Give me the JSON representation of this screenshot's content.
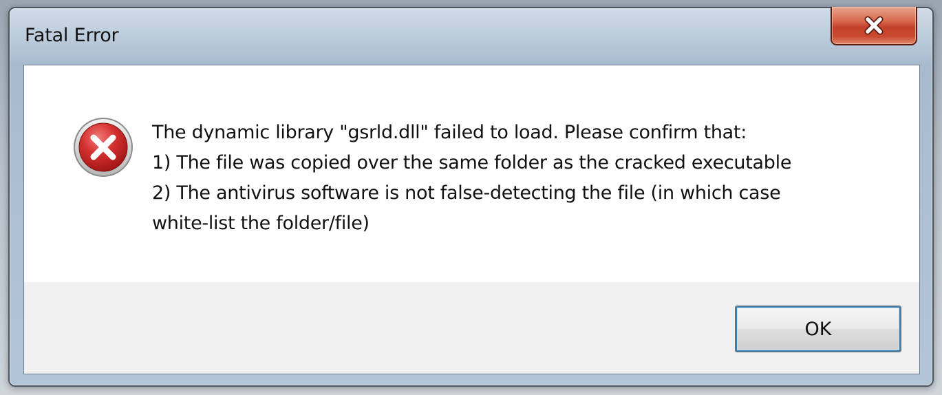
{
  "dialog": {
    "title": "Fatal Error",
    "close_label": "Close",
    "message_lines": [
      "The dynamic library \"gsrld.dll\" failed to load. Please confirm that:",
      "1) The file was copied over the same folder as the cracked executable",
      "2) The antivirus software is not false-detecting the file (in which case",
      "white-list the folder/file)"
    ],
    "ok_label": "OK"
  },
  "icons": {
    "close": "close-icon",
    "error": "error-icon"
  },
  "colors": {
    "close_button": "#c94a31",
    "error_icon": "#c0262b",
    "focus_ring": "#3c7fb1"
  }
}
